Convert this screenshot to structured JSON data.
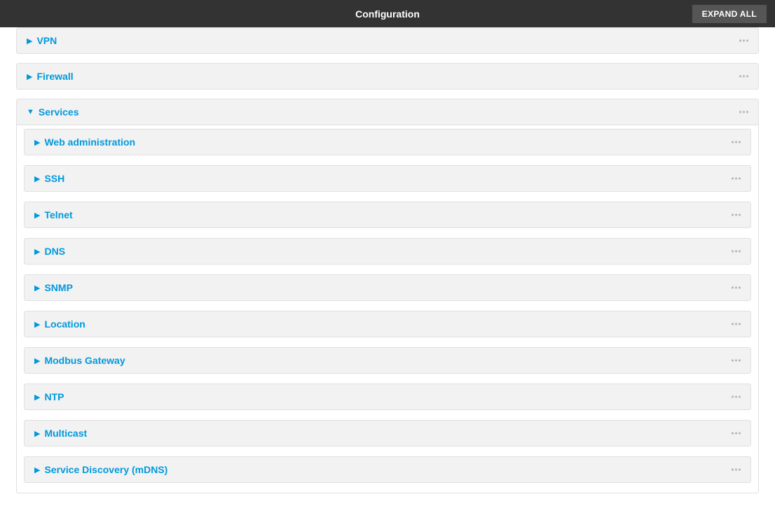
{
  "header": {
    "title": "Configuration",
    "expand_all": "EXPAND ALL"
  },
  "top_panels": [
    {
      "label": "VPN",
      "id": "vpn"
    },
    {
      "label": "Firewall",
      "id": "firewall"
    }
  ],
  "services": {
    "label": "Services",
    "id": "services",
    "items": [
      {
        "label": "Web administration",
        "id": "web-administration"
      },
      {
        "label": "SSH",
        "id": "ssh"
      },
      {
        "label": "Telnet",
        "id": "telnet"
      },
      {
        "label": "DNS",
        "id": "dns"
      },
      {
        "label": "SNMP",
        "id": "snmp"
      },
      {
        "label": "Location",
        "id": "location"
      },
      {
        "label": "Modbus Gateway",
        "id": "modbus-gateway"
      },
      {
        "label": "NTP",
        "id": "ntp"
      },
      {
        "label": "Multicast",
        "id": "multicast"
      },
      {
        "label": "Service Discovery (mDNS)",
        "id": "service-discovery-mdns"
      }
    ]
  }
}
